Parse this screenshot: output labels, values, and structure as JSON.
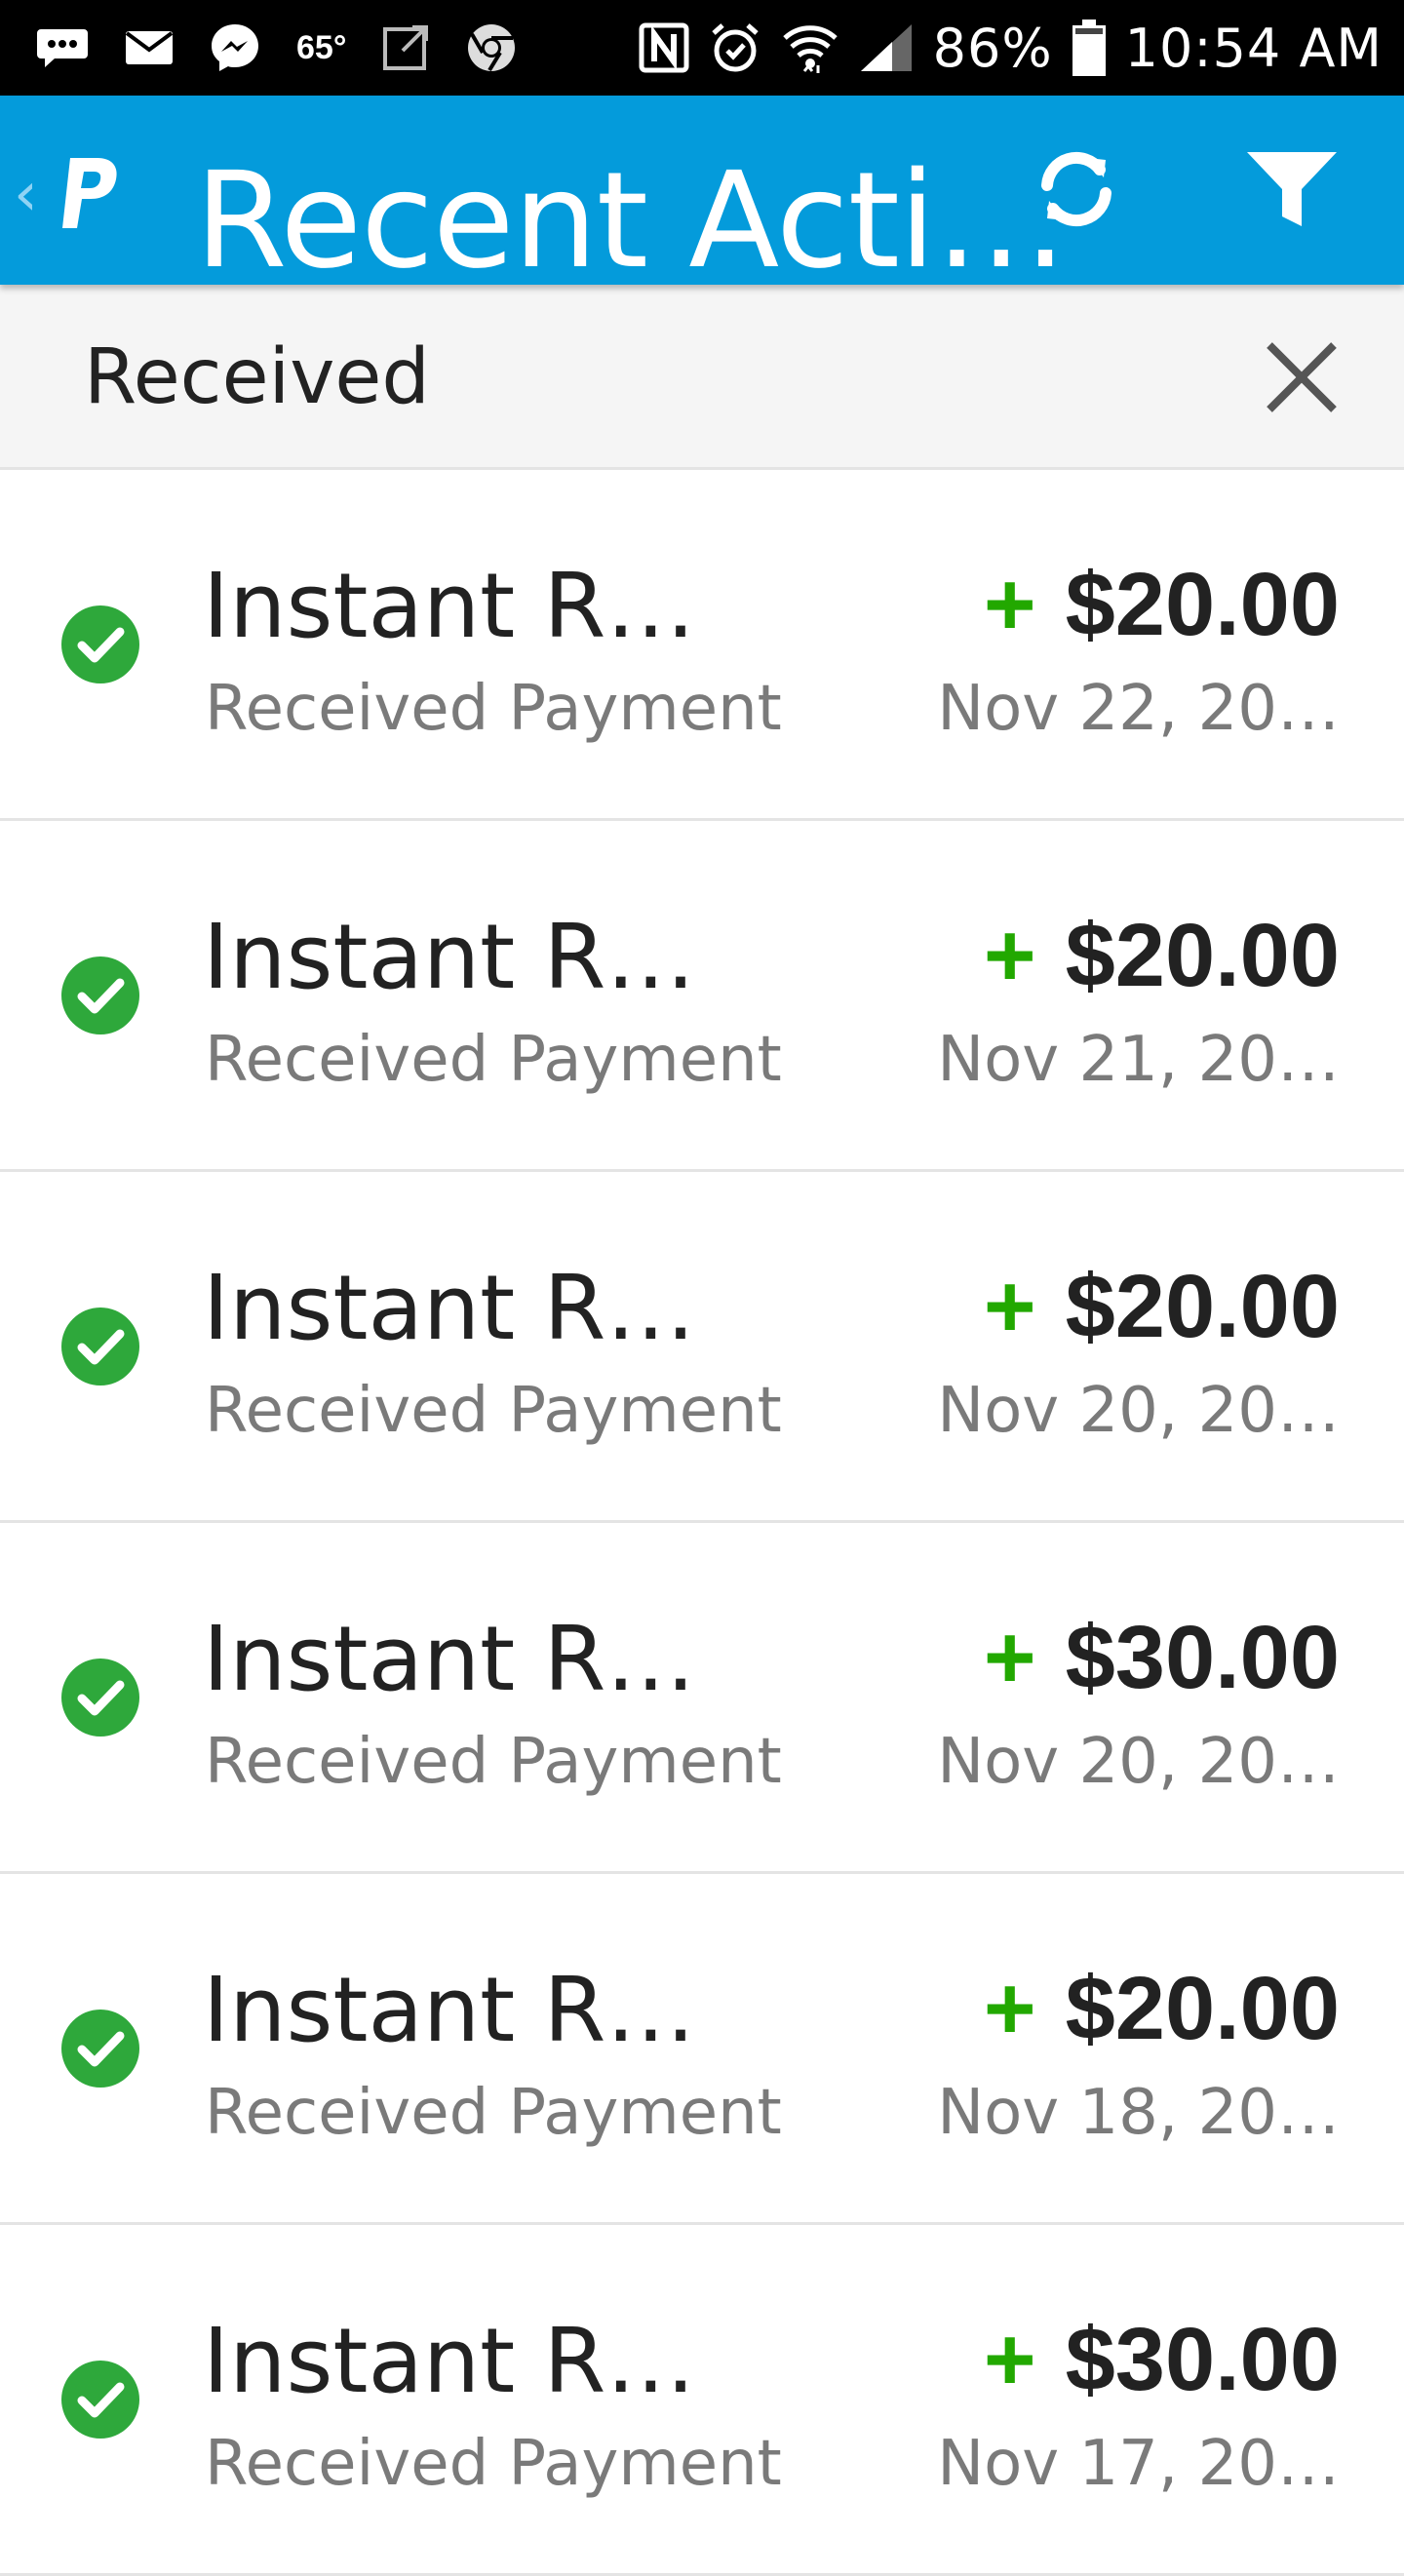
{
  "status_bar": {
    "temperature": "65°",
    "battery": "86%",
    "time": "10:54 AM",
    "icons": [
      "chat-icon",
      "mail-icon",
      "messenger-icon",
      "weather-temp",
      "external-link-icon",
      "chrome-icon",
      "nfc-icon",
      "alarm-icon",
      "wifi-icon",
      "signal-icon",
      "battery-icon"
    ]
  },
  "app_bar": {
    "title": "Recent Acti…",
    "back_icon": "chevron-left-icon",
    "logo_icon": "paypal-logo-icon",
    "refresh_icon": "refresh-icon",
    "filter_icon": "filter-icon",
    "color": "#049BDB"
  },
  "filter": {
    "label": "Received",
    "close_icon": "close-icon"
  },
  "activities": [
    {
      "title": "Instant R…",
      "subtitle": "Received Payment",
      "sign": "+",
      "amount": "$20.00",
      "date": "Nov 22, 20…"
    },
    {
      "title": "Instant R…",
      "subtitle": "Received Payment",
      "sign": "+",
      "amount": "$20.00",
      "date": "Nov 21, 20…"
    },
    {
      "title": "Instant R…",
      "subtitle": "Received Payment",
      "sign": "+",
      "amount": "$20.00",
      "date": "Nov 20, 20…"
    },
    {
      "title": "Instant R…",
      "subtitle": "Received Payment",
      "sign": "+",
      "amount": "$30.00",
      "date": "Nov 20, 20…"
    },
    {
      "title": "Instant R…",
      "subtitle": "Received Payment",
      "sign": "+",
      "amount": "$20.00",
      "date": "Nov 18, 20…"
    },
    {
      "title": "Instant R…",
      "subtitle": "Received Payment",
      "sign": "+",
      "amount": "$30.00",
      "date": "Nov 17, 20…"
    }
  ],
  "colors": {
    "success": "#2ea83b",
    "plus": "#22a800"
  }
}
